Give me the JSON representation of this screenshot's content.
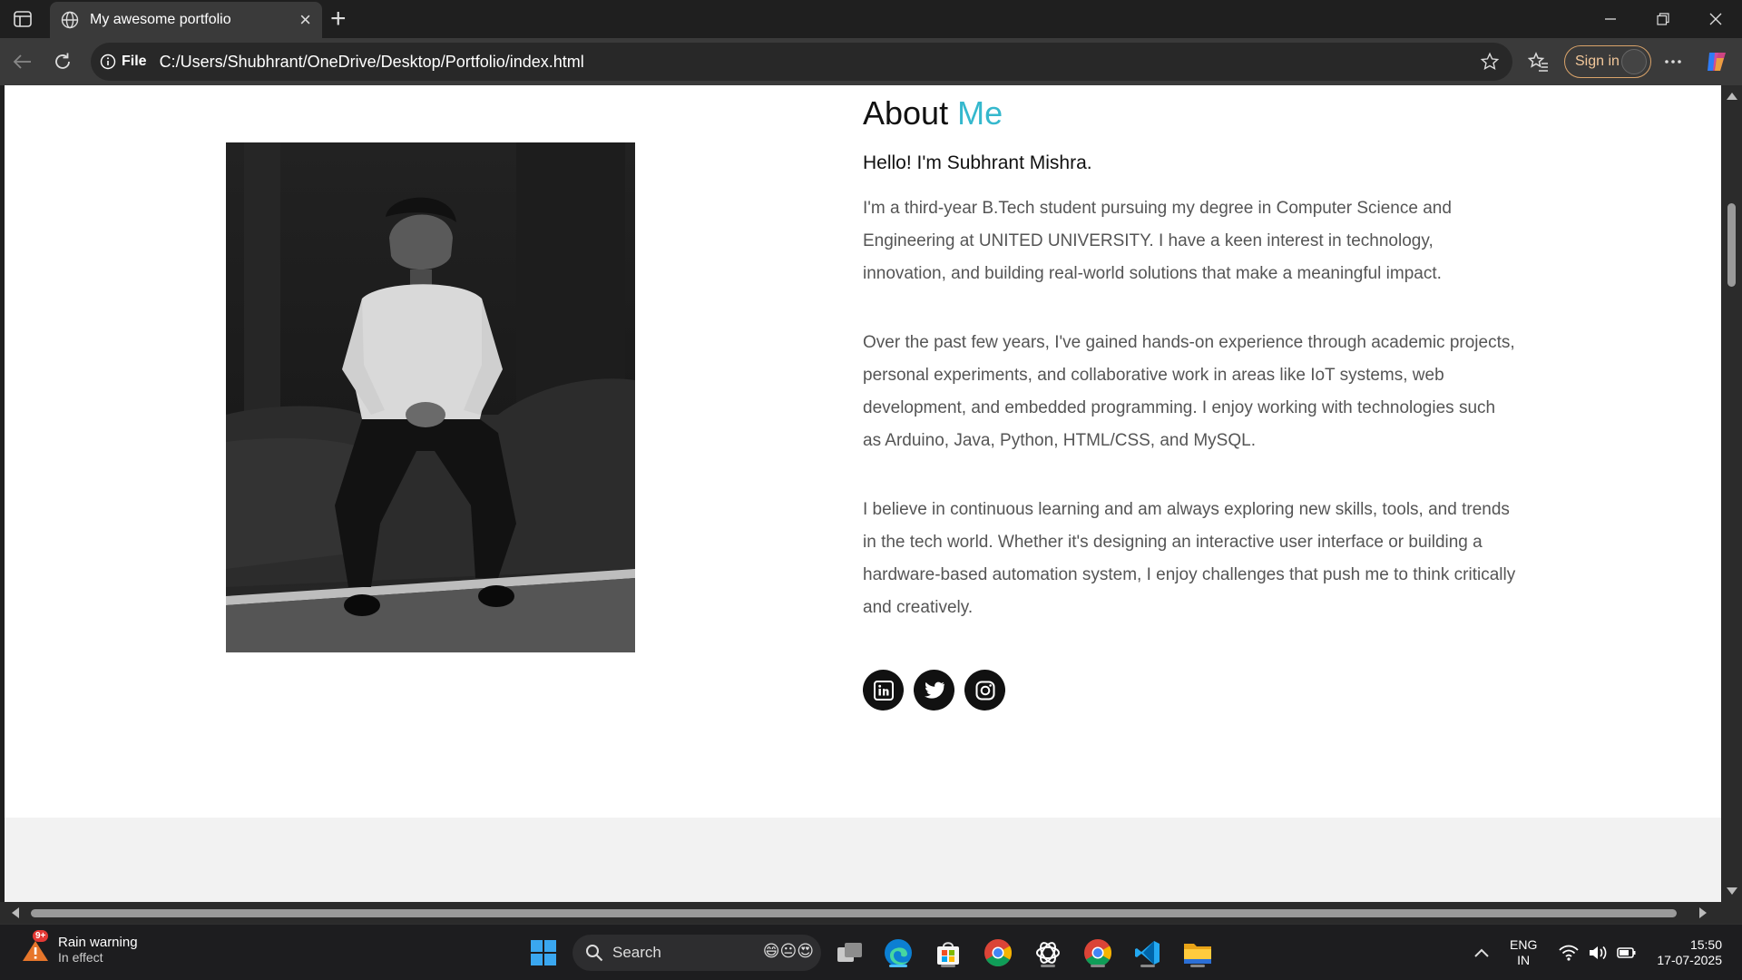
{
  "browser": {
    "tab_title": "My awesome portfolio",
    "address_prefix": "File",
    "url": "C:/Users/Shubhrant/OneDrive/Desktop/Portfolio/index.html",
    "sign_in_label": "Sign in"
  },
  "about": {
    "heading_word1": "About",
    "heading_word2": "Me",
    "greeting": "Hello! I'm Subhrant Mishra.",
    "paragraphs": [
      "I'm a third-year B.Tech student pursuing my degree in Computer Science and Engineering at UNITED UNIVERSITY. I have a keen interest in technology, innovation, and building real-world solutions that make a meaningful impact.",
      "Over the past few years, I've gained hands-on experience through academic projects, personal experiments, and collaborative work in areas like IoT systems, web development, and embedded programming. I enjoy working with technologies such as Arduino, Java, Python, HTML/CSS, and MySQL.",
      "I believe in continuous learning and am always exploring new skills, tools, and trends in the tech world. Whether it's designing an interactive user interface or building a hardware-based automation system, I enjoy challenges that push me to think critically and creatively."
    ],
    "socials": [
      "linkedin-icon",
      "twitter-icon",
      "instagram-icon"
    ],
    "accent_color": "#35b8cd"
  },
  "taskbar": {
    "weather_badge": "9+",
    "weather_title": "Rain warning",
    "weather_sub": "In effect",
    "search_placeholder": "Search",
    "lang_top": "ENG",
    "lang_bottom": "IN",
    "time": "15:50",
    "date": "17-07-2025"
  }
}
